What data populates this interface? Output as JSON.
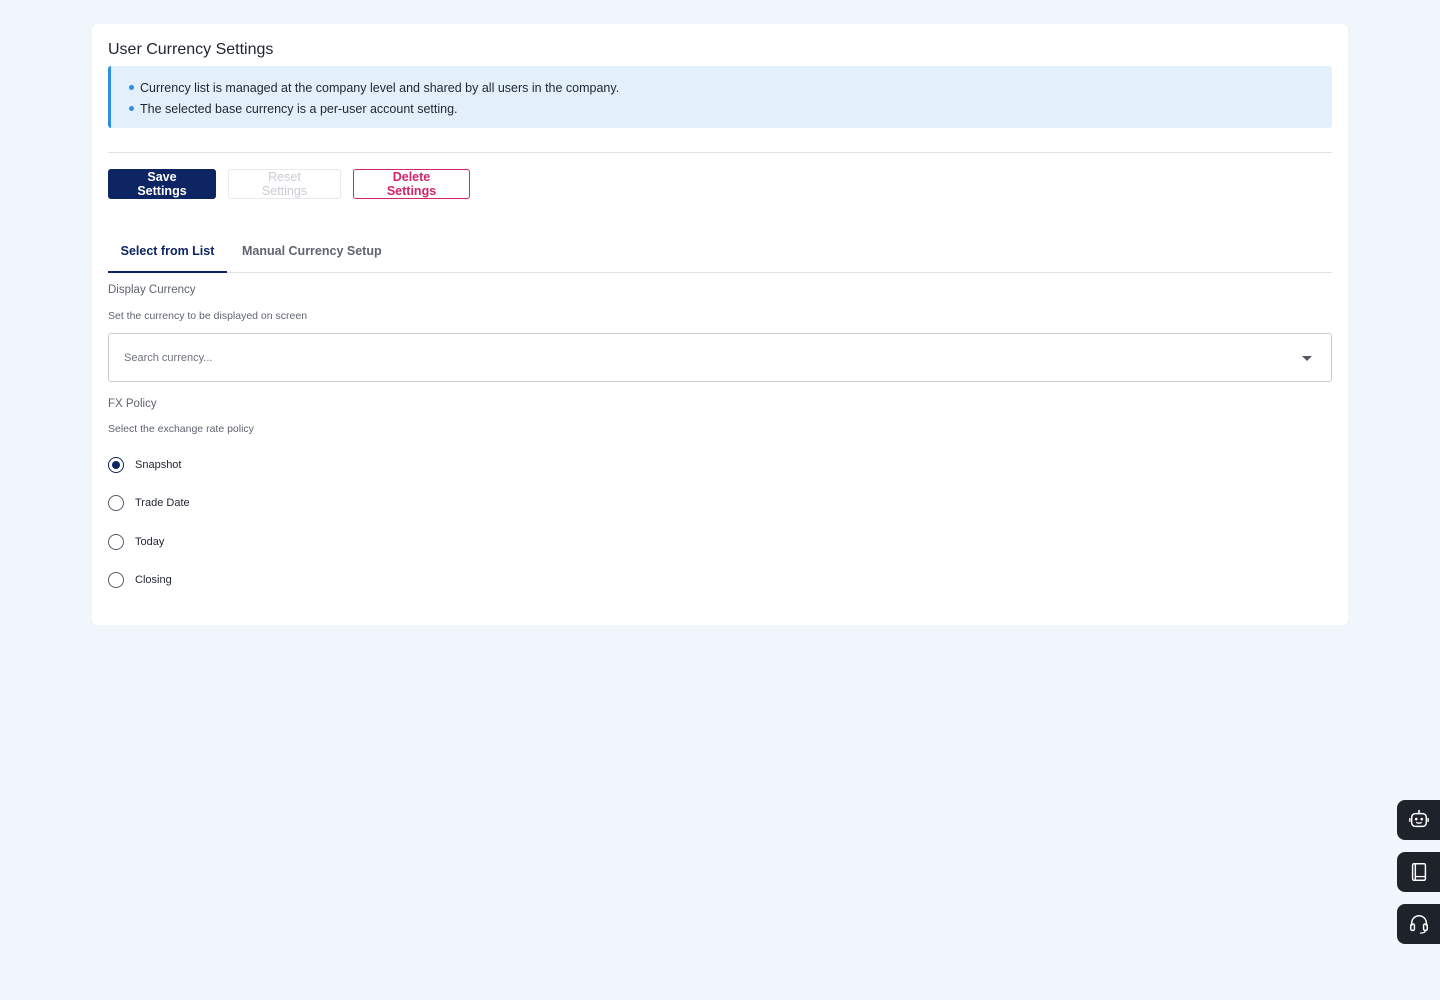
{
  "page": {
    "title": "User Currency Settings"
  },
  "info": {
    "lines": [
      "Currency list is managed at the company level and shared by all users in the company.",
      "The selected base currency is a per-user account setting."
    ]
  },
  "toolbar": {
    "save_label": "Save Settings",
    "reset_label": "Reset Settings",
    "delete_label": "Delete Settings"
  },
  "tabs": [
    {
      "label": "Select from List",
      "active": true
    },
    {
      "label": "Manual Currency Setup",
      "active": false
    }
  ],
  "display_currency": {
    "label": "Display Currency",
    "help": "Set the currency to be displayed on screen",
    "value": "",
    "placeholder": "Search currency..."
  },
  "fx_policy": {
    "label": "FX Policy",
    "help": "Select the exchange rate policy",
    "options": [
      {
        "label": "Snapshot",
        "selected": true
      },
      {
        "label": "Trade Date",
        "selected": false
      },
      {
        "label": "Today",
        "selected": false
      },
      {
        "label": "Closing",
        "selected": false
      }
    ]
  },
  "side_actions": [
    {
      "icon": "robot-assistant-icon"
    },
    {
      "icon": "notebook-icon"
    },
    {
      "icon": "headset-support-icon"
    }
  ],
  "colors": {
    "primary": "#0d2563",
    "danger": "#d4246c",
    "info_accent": "#2d8fe4",
    "info_bg": "#e3f0fb",
    "page_bg": "#f1f5fc"
  }
}
